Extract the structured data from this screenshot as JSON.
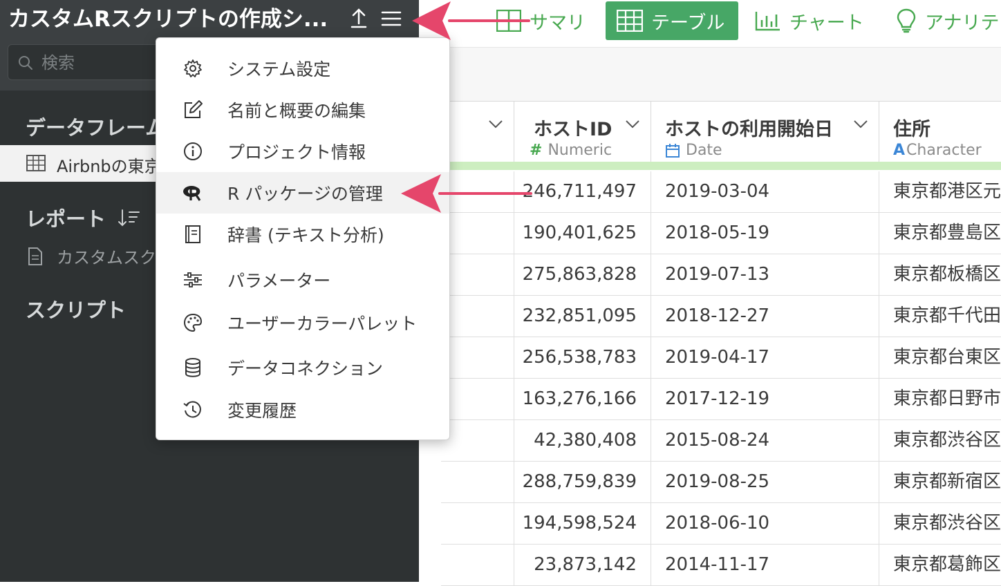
{
  "sidebar": {
    "project_title": "カスタムRスクリプトの作成シ...",
    "search_placeholder": "検索",
    "dataframes_title": "データフレーム",
    "dataframe_item": "Airbnbの東京",
    "reports_title": "レポート",
    "report_item": "カスタムスク",
    "scripts_title": "スクリプト"
  },
  "nav": {
    "summary": "サマリ",
    "table": "テーブル",
    "chart": "チャート",
    "analytics": "アナリテ"
  },
  "menu": {
    "items": [
      {
        "label": "システム設定",
        "icon": "gear-icon"
      },
      {
        "label": "名前と概要の編集",
        "icon": "edit-icon"
      },
      {
        "label": "プロジェクト情報",
        "icon": "info-icon"
      },
      {
        "label": "R パッケージの管理",
        "icon": "r-logo-icon"
      },
      {
        "label": "辞書 (テキスト分析)",
        "icon": "book-icon"
      },
      {
        "label": "パラメーター",
        "icon": "sliders-icon"
      },
      {
        "label": "ユーザーカラーパレット",
        "icon": "palette-icon"
      },
      {
        "label": "データコネクション",
        "icon": "database-icon"
      },
      {
        "label": "変更履歴",
        "icon": "history-icon"
      }
    ],
    "highlighted_index": 3
  },
  "table": {
    "columns": [
      {
        "name": "ホストID",
        "type_symbol": "#",
        "type": "Numeric"
      },
      {
        "name": "ホストの利用開始日",
        "type_symbol": "calendar",
        "type": "Date"
      },
      {
        "name": "住所",
        "type_symbol": "A",
        "type": "Character"
      }
    ],
    "rows": [
      [
        "246,711,497",
        "2019-03-04",
        "東京都港区元"
      ],
      [
        "190,401,625",
        "2018-05-19",
        "東京都豊島区"
      ],
      [
        "275,863,828",
        "2019-07-13",
        "東京都板橋区"
      ],
      [
        "232,851,095",
        "2018-12-27",
        "東京都千代田"
      ],
      [
        "256,538,783",
        "2019-04-17",
        "東京都台東区"
      ],
      [
        "163,276,166",
        "2017-12-19",
        "東京都日野市"
      ],
      [
        "42,380,408",
        "2015-08-24",
        "東京都渋谷区"
      ],
      [
        "288,759,839",
        "2019-08-25",
        "東京都新宿区"
      ],
      [
        "194,598,524",
        "2018-06-10",
        "東京都渋谷区"
      ],
      [
        "23,873,142",
        "2014-11-17",
        "東京都葛飾区"
      ]
    ]
  },
  "colors": {
    "accent_green": "#47a766",
    "arrow_pink": "#e5466b",
    "sidebar_bg": "#2e3233"
  }
}
